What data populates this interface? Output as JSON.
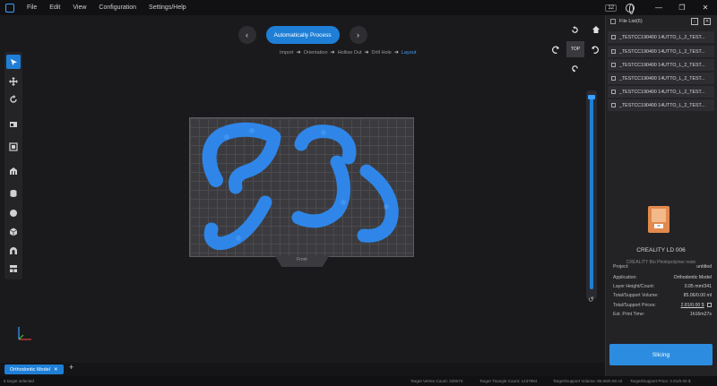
{
  "menu": {
    "items": [
      "File",
      "Edit",
      "View",
      "Configuration",
      "Settings/Help"
    ]
  },
  "titlebar": {
    "badge": "12",
    "minimize": "—",
    "restore": "❐",
    "close": "✕"
  },
  "toolbar_top": {
    "prev": "‹",
    "primary_button": "Automatically Process",
    "next": "›",
    "steps": [
      "Import",
      "Orientation",
      "Hollow Out",
      "Drill Hole",
      "Layout"
    ],
    "active_step": "Layout"
  },
  "view_controls": {
    "cube_label": "TOP",
    "icons": [
      "home-icon",
      "rotate-ccw-icon",
      "rotate-cw-icon",
      "rotate-left-icon",
      "rotate-right-icon",
      "rotate-down-icon"
    ]
  },
  "left_tools": {
    "icons": [
      "select-icon",
      "move-icon",
      "rotate-icon",
      "scale-icon",
      "mirror-icon",
      "support-icon",
      "hollow-icon",
      "sphere-icon",
      "cube-icon",
      "arch-icon",
      "layout-icon"
    ]
  },
  "plate": {
    "label": "Front"
  },
  "tabs": {
    "model_tab": "Orthodontic Model",
    "add": "+"
  },
  "statusbar": {
    "selection": "6 target selected",
    "vertex_count": "Target Vertex Count: 328073",
    "triangle_count": "Target Triangle Count: 1237984",
    "support_volume": "Target/Support Volume: 85.06/0.00 ml",
    "support_price": "Target/Support Price: 2.81/0.00 $"
  },
  "file_list": {
    "header": "File List(6)",
    "files": [
      "_TESTCC190400 14UTTO_L_2_TEST...",
      "_TESTCC190400 14UTTO_L_2_TEST...",
      "_TESTCC190400 14UTTO_L_2_TEST...",
      "_TESTCC190400 14UTTO_L_2_TEST...",
      "_TESTCC190400 14UTTO_L_2_TEST...",
      "_TESTCC190400 14UTTO_L_2_TEST..."
    ]
  },
  "printer": {
    "name": "CREALITY LD 006",
    "resin": "CREALITY Bio Photopolymer resin",
    "screen": "06"
  },
  "info": {
    "rows": [
      {
        "key": "Project:",
        "value": "untitled"
      },
      {
        "key": "Application:",
        "value": "Orthodontic Model"
      },
      {
        "key": "Layer Height/Count:",
        "value": "0.05 mm/341"
      },
      {
        "key": "Total/Support Volume:",
        "value": "85.06/0.00 ml"
      },
      {
        "key": "Total/Support Prices:",
        "value": "2.81/0.00 $"
      },
      {
        "key": "Est. Print Time:",
        "value": "1h16m27s"
      }
    ]
  },
  "slicing_button": "Slicing",
  "slider": {
    "reset": "↺",
    "level": 1.0
  },
  "colors": {
    "accent": "#1f7fd7",
    "model": "#2f86e8",
    "plate": "#3b3b3f"
  }
}
